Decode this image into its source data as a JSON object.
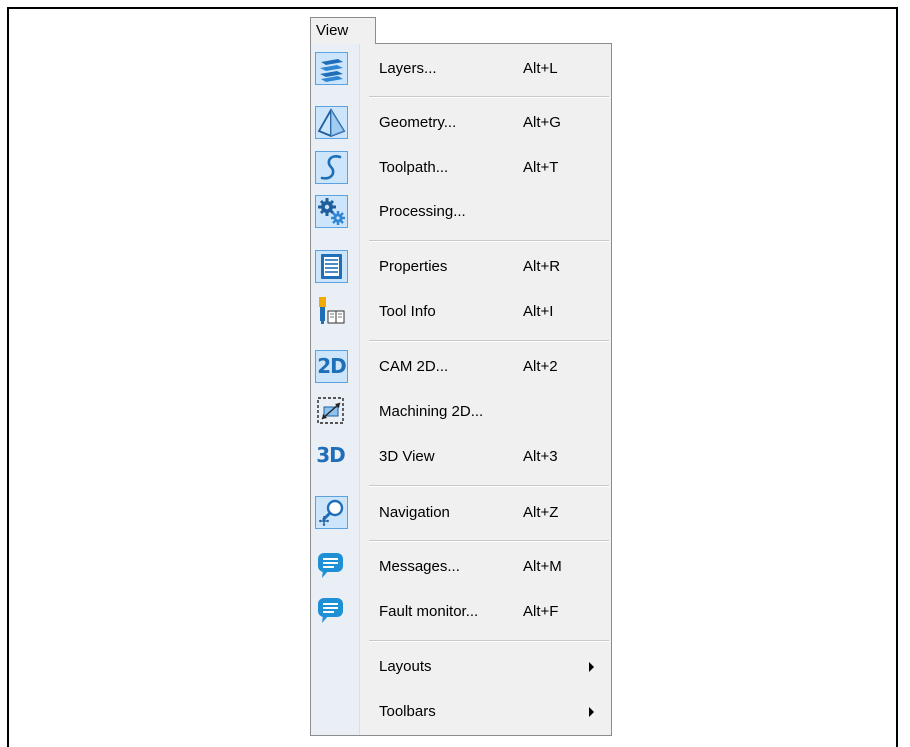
{
  "menu_title": "View",
  "items": [
    {
      "label": "Layers...",
      "shortcut": "Alt+L",
      "icon": "layers-icon"
    },
    {
      "label": "Geometry...",
      "shortcut": "Alt+G",
      "icon": "pyramid-icon"
    },
    {
      "label": "Toolpath...",
      "shortcut": "Alt+T",
      "icon": "toolpath-curve-icon"
    },
    {
      "label": "Processing...",
      "shortcut": "",
      "icon": "gears-icon"
    },
    {
      "label": "Properties",
      "shortcut": "Alt+R",
      "icon": "document-list-icon"
    },
    {
      "label": "Tool Info",
      "shortcut": "Alt+I",
      "icon": "tool-book-icon"
    },
    {
      "label": "CAM 2D...",
      "shortcut": "Alt+2",
      "icon": "2d-icon",
      "icon_text": "2D"
    },
    {
      "label": "Machining 2D...",
      "shortcut": "",
      "icon": "machining-frame-icon"
    },
    {
      "label": "3D View",
      "shortcut": "Alt+3",
      "icon": "3d-icon",
      "icon_text": "3D"
    },
    {
      "label": "Navigation",
      "shortcut": "Alt+Z",
      "icon": "magnifier-move-icon"
    },
    {
      "label": "Messages...",
      "shortcut": "Alt+M",
      "icon": "speech-bubble-icon"
    },
    {
      "label": "Fault monitor...",
      "shortcut": "Alt+F",
      "icon": "speech-bubble-icon"
    },
    {
      "label": "Layouts",
      "shortcut": "",
      "icon": "",
      "submenu": true
    },
    {
      "label": "Toolbars",
      "shortcut": "",
      "icon": "",
      "submenu": true
    }
  ],
  "colors": {
    "menu_background": "#f0f0f0",
    "icon_highlight": "#cde5fb",
    "icon_blue": "#1f6fb8"
  }
}
